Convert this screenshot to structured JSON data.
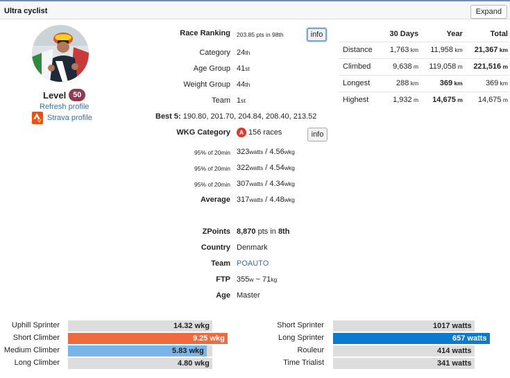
{
  "header": {
    "title": "Ultra cyclist",
    "expand_label": "Expand"
  },
  "profile": {
    "level_label": "Level",
    "level_value": "50",
    "refresh_label": "Refresh profile",
    "strava_label": "Strava profile",
    "avatar_icon": "cyclist-avatar"
  },
  "ranking": {
    "race_ranking_label": "Race Ranking",
    "race_ranking_pts": "203.85",
    "race_ranking_mid": " pts in ",
    "race_ranking_place": "98th",
    "info_label": "info",
    "category_label": "Category",
    "category_value": "24",
    "category_suffix": "th",
    "age_group_label": "Age Group",
    "age_group_value": "41",
    "age_group_suffix": "st",
    "weight_group_label": "Weight Group",
    "weight_group_value": "44",
    "weight_group_suffix": "th",
    "team_label": "Team",
    "team_value": "1",
    "team_suffix": "st",
    "best5_label": "Best 5:",
    "best5_value": " 190.80, 201.70, 204.84, 208.40, 213.52"
  },
  "wkg": {
    "label": "WKG Category",
    "badge": "A",
    "races": "156 races",
    "info_label": "info",
    "rows": [
      {
        "label": "95% of 20min",
        "watts": "323",
        "wkg": "4.56"
      },
      {
        "label": "95% of 20min",
        "watts": "322",
        "wkg": "4.54"
      },
      {
        "label": "95% of 20min",
        "watts": "307",
        "wkg": "4.34"
      }
    ],
    "average_label": "Average",
    "average_watts": "317",
    "average_wkg": "4.48",
    "watts_unit": "watts",
    "wkg_unit": "wkg"
  },
  "details": {
    "zpoints_label": "ZPoints",
    "zpoints_value": "8,870",
    "zpoints_mid": " pts in ",
    "zpoints_place": "8th",
    "country_label": "Country",
    "country_value": "Denmark",
    "team_label": "Team",
    "team_value": "POAUTO",
    "ftp_label": "FTP",
    "ftp_watts": "355",
    "ftp_w_unit": "w",
    "ftp_sep": " ~ ",
    "ftp_weight": "71",
    "ftp_kg_unit": "kg",
    "age_label": "Age",
    "age_value": "Master"
  },
  "stats": {
    "headers": [
      "",
      "30 Days",
      "Year",
      "Total"
    ],
    "rows": [
      {
        "label": "Distance",
        "d30": "1,763",
        "d30u": "km",
        "year": "11,958",
        "yearu": "km",
        "total": "21,367",
        "totalu": "km",
        "bold": "total"
      },
      {
        "label": "Climbed",
        "d30": "9,638",
        "d30u": "m",
        "year": "119,058",
        "yearu": "m",
        "total": "221,516",
        "totalu": "m",
        "bold": "total"
      },
      {
        "label": "Longest",
        "d30": "288",
        "d30u": "km",
        "year": "369",
        "yearu": "km",
        "total": "369",
        "totalu": "km",
        "bold": "year"
      },
      {
        "label": "Highest",
        "d30": "1,932",
        "d30u": "m",
        "year": "14,675",
        "yearu": "m",
        "total": "14,675",
        "totalu": "m",
        "bold": "year"
      }
    ]
  },
  "rider_types": {
    "left": [
      {
        "label": "Uphill Sprinter",
        "value": "14.32 wkg",
        "fraction": 0.0,
        "color": "#dddddd",
        "white": false
      },
      {
        "label": "Short Climber",
        "value": "9.25 wkg",
        "fraction": 1.0,
        "color": "#f06a3f",
        "white": true
      },
      {
        "label": "Medium Climber",
        "value": "5.83 wkg",
        "fraction": 0.96,
        "color": "#7ab5ea",
        "white": false
      },
      {
        "label": "Long Climber",
        "value": "4.80 wkg",
        "fraction": 0.0,
        "color": "#dddddd",
        "white": false
      }
    ],
    "right": [
      {
        "label": "Short Sprinter",
        "value": "1017 watts",
        "fraction": 0.0,
        "color": "#dddddd",
        "white": false
      },
      {
        "label": "Long Sprinter",
        "value": "657 watts",
        "fraction": 1.0,
        "color": "#0a7bd0",
        "white": true
      },
      {
        "label": "Rouleur",
        "value": "414 watts",
        "fraction": 0.0,
        "color": "#dddddd",
        "white": false
      },
      {
        "label": "Time Trialist",
        "value": "341 watts",
        "fraction": 0.0,
        "color": "#dddddd",
        "white": false
      }
    ]
  }
}
